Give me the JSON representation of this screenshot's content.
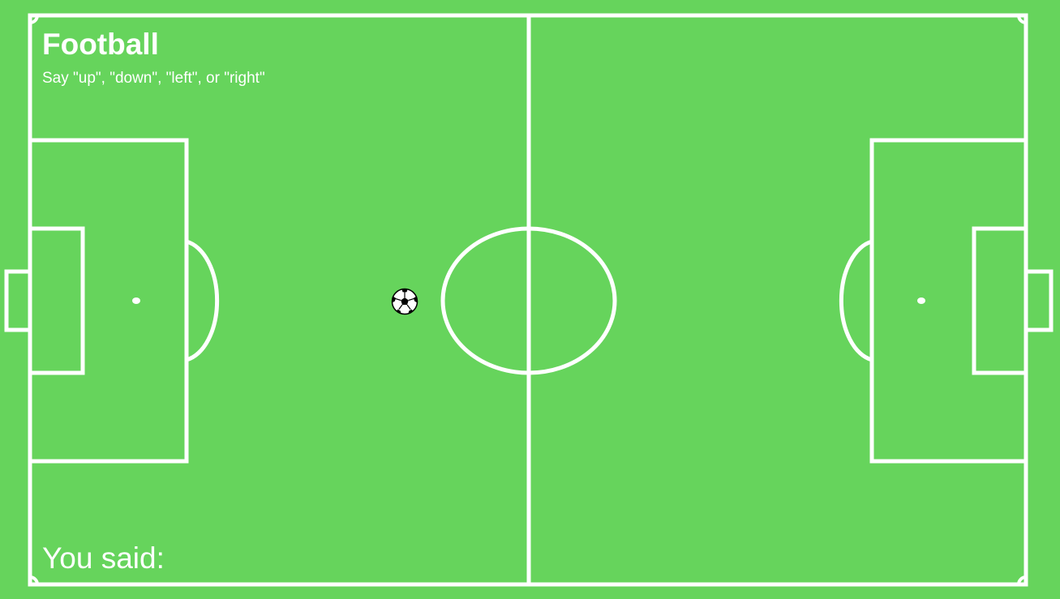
{
  "game": {
    "title": "Football",
    "instructions": "Say \"up\", \"down\", \"left\", or \"right\"",
    "you_said_label": "You said:",
    "you_said_value": ""
  },
  "colors": {
    "grass": "#66d45c",
    "lines": "#ffffff",
    "ball_black": "#000000",
    "ball_white": "#ffffff"
  },
  "icons": {
    "ball": "soccer-ball-icon"
  }
}
